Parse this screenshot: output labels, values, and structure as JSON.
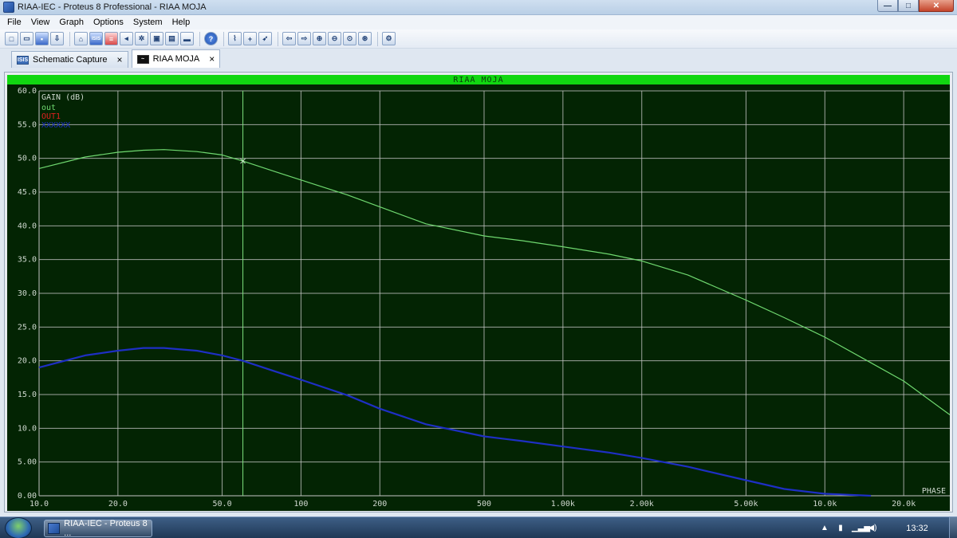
{
  "window": {
    "title": "RIAA-IEC - Proteus 8 Professional - RIAA MOJA",
    "min_glyph": "—",
    "max_glyph": "□",
    "close_glyph": "✕"
  },
  "menu": [
    "File",
    "View",
    "Graph",
    "Options",
    "System",
    "Help"
  ],
  "toolbar": {
    "group1": [
      "new-file-icon",
      "open-folder-icon",
      "save-icon",
      "import-icon",
      "home-icon",
      "isis-icon",
      "bom-icon",
      "component-icon",
      "gear-icon",
      "pcb-icon",
      "script-icon",
      "bus-icon",
      "help-icon"
    ],
    "group2": [
      "graph-simulate-icon",
      "add-trace-icon",
      "run-icon"
    ],
    "group3": [
      "arrow-left-icon",
      "arrow-right-icon",
      "zoom-in-icon",
      "zoom-out-icon",
      "zoom-all-icon",
      "zoom-area-icon"
    ],
    "group4": [
      "graph-settings-icon"
    ],
    "isis_text": "ISIS",
    "help_text": "?"
  },
  "tabs": [
    {
      "label": "Schematic Capture",
      "icon": "ISIS",
      "active": false
    },
    {
      "label": "RIAA MOJA",
      "icon": "~",
      "active": true
    }
  ],
  "tab_close": "×",
  "graph": {
    "title": "RIAA MOJA",
    "bg_color": "#032403",
    "grid_color": "#c4c4c4",
    "header_color": "#11d711",
    "phase_label": "PHASE"
  },
  "chart_data": {
    "type": "line",
    "title": "RIAA MOJA",
    "ylabel": "GAIN (dB)",
    "xlabel": "",
    "x_scale": "log",
    "xlim": [
      10,
      30000
    ],
    "ylim": [
      0,
      60
    ],
    "x_ticks": [
      10,
      20,
      50,
      100,
      200,
      500,
      1000,
      2000,
      5000,
      10000,
      20000
    ],
    "x_tick_labels": [
      "10.0",
      "20.0",
      "50.0",
      "100",
      "200",
      "500",
      "1.00k",
      "2.00k",
      "5.00k",
      "10.0k",
      "20.0k"
    ],
    "y_ticks": [
      0,
      5,
      10,
      15,
      20,
      25,
      30,
      35,
      40,
      45,
      50,
      55,
      60
    ],
    "y_tick_labels": [
      "0.00",
      "5.00",
      "10.0",
      "15.0",
      "20.0",
      "25.0",
      "30.0",
      "35.0",
      "40.0",
      "45.0",
      "50.0",
      "55.0",
      "60.0"
    ],
    "grid": true,
    "cursor_x": 60,
    "cursor_marker": {
      "x": 60,
      "y": 49.6
    },
    "series": [
      {
        "name": "out",
        "color": "#6fd86f",
        "x": [
          10,
          15,
          20,
          25,
          30,
          40,
          50,
          60,
          80,
          100,
          150,
          200,
          300,
          500,
          700,
          1000,
          1500,
          2000,
          3000,
          5000,
          7000,
          10000,
          15000,
          20000,
          30000
        ],
        "y": [
          48.5,
          50.2,
          50.9,
          51.2,
          51.3,
          51.0,
          50.5,
          49.6,
          48.0,
          46.8,
          44.6,
          42.8,
          40.3,
          38.5,
          37.8,
          36.9,
          35.8,
          34.8,
          32.7,
          29.0,
          26.4,
          23.5,
          19.7,
          17.0,
          12.0
        ]
      },
      {
        "name": "OUT1",
        "color": "#e02020",
        "x": [],
        "y": []
      },
      {
        "name": "XXXXXX",
        "color": "#1e2fc4",
        "x": [
          10,
          15,
          20,
          25,
          30,
          40,
          50,
          60,
          80,
          100,
          150,
          200,
          300,
          500,
          700,
          1000,
          1500,
          2000,
          3000,
          5000,
          7000,
          10000,
          15000
        ],
        "y": [
          19.0,
          20.8,
          21.5,
          21.9,
          21.9,
          21.5,
          20.8,
          20.0,
          18.4,
          17.2,
          14.9,
          12.9,
          10.6,
          8.8,
          8.1,
          7.3,
          6.4,
          5.6,
          4.3,
          2.3,
          1.0,
          0.3,
          0.0
        ]
      }
    ]
  },
  "taskbar": {
    "task_label": "RIAA-IEC - Proteus 8 ...",
    "clock": "13:32"
  }
}
